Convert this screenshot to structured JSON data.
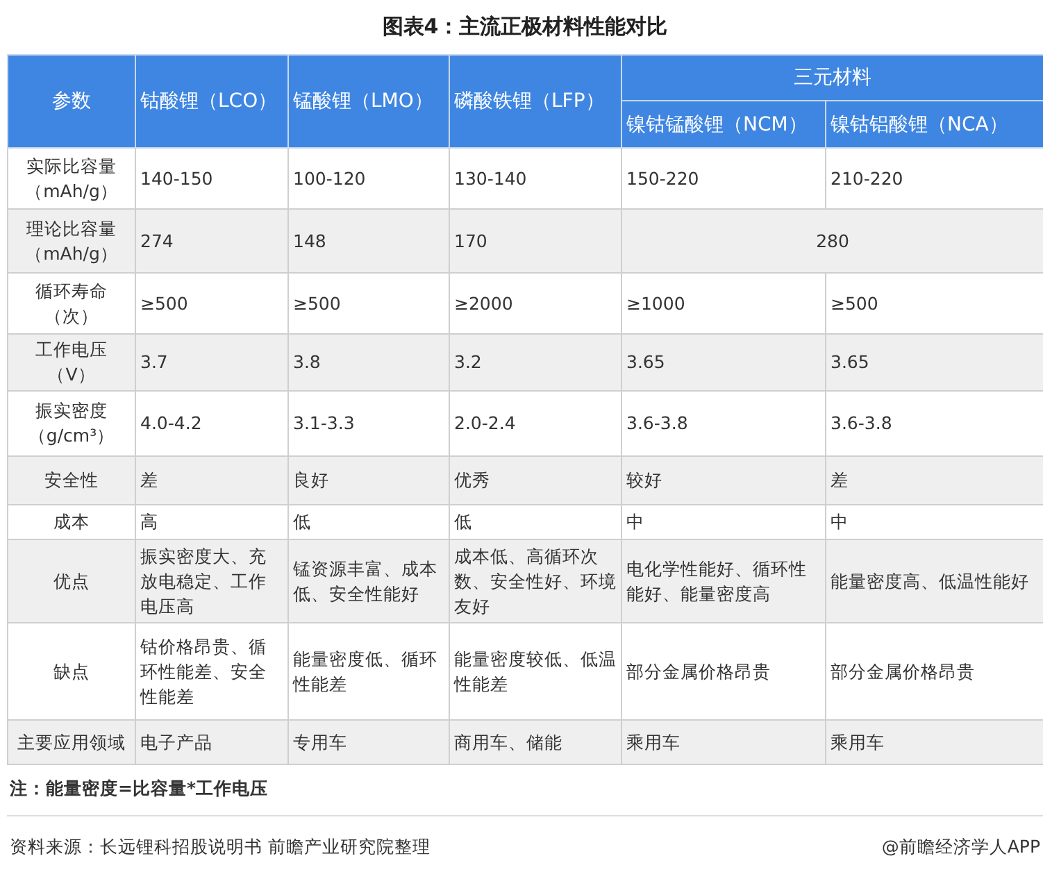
{
  "title": "图表4：主流正极材料性能对比",
  "header": {
    "param_label": "参数",
    "columns": [
      "钴酸锂（LCO）",
      "锰酸锂（LMO）",
      "磷酸铁锂（LFP）"
    ],
    "group": {
      "label": "三元材料",
      "columns": [
        "镍钴锰酸锂（NCM）",
        "镍钴铝酸锂（NCA）"
      ]
    }
  },
  "rows": [
    {
      "label": "实际比容量（mAh/g）",
      "cells": [
        "140-150",
        "100-120",
        "130-140",
        "150-220",
        "210-220"
      ]
    },
    {
      "label": "理论比容量（mAh/g）",
      "cells": [
        "274",
        "148",
        "170",
        "280"
      ]
    },
    {
      "label": "循环寿命（次）",
      "cells": [
        "≥500",
        "≥500",
        "≥2000",
        "≥1000",
        "≥500"
      ]
    },
    {
      "label": "工作电压（V）",
      "cells": [
        "3.7",
        "3.8",
        "3.2",
        "3.65",
        "3.65"
      ]
    },
    {
      "label": "振实密度（g/cm³）",
      "cells": [
        "4.0-4.2",
        "3.1-3.3",
        "2.0-2.4",
        "3.6-3.8",
        "3.6-3.8"
      ]
    },
    {
      "label": "安全性",
      "cells": [
        "差",
        "良好",
        "优秀",
        "较好",
        "差"
      ]
    },
    {
      "label": "成本",
      "cells": [
        "高",
        "低",
        "低",
        "中",
        "中"
      ]
    },
    {
      "label": "优点",
      "cells": [
        "振实密度大、充放电稳定、工作电压高",
        "锰资源丰富、成本低、安全性能好",
        "成本低、高循环次数、安全性好、环境友好",
        "电化学性能好、循环性能好、能量密度高",
        "能量密度高、低温性能好"
      ]
    },
    {
      "label": "缺点",
      "cells": [
        "钴价格昂贵、循环性能差、安全性能差",
        "能量密度低、循环性能差",
        "能量密度较低、低温性能差",
        "部分金属价格昂贵",
        "部分金属价格昂贵"
      ]
    },
    {
      "label": "主要应用领域",
      "cells": [
        "电子产品",
        "专用车",
        "商用车、储能",
        "乘用车",
        "乘用车"
      ]
    }
  ],
  "note": "注：能量密度=比容量*工作电压",
  "source": "资料来源：长远锂科招股说明书 前瞻产业研究院整理",
  "credit": "@前瞻经济学人APP"
}
